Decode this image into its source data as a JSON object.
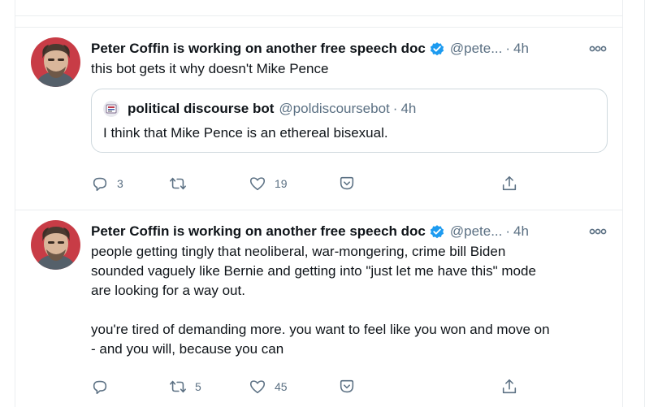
{
  "tweets": [
    {
      "display_name": "Peter Coffin is working on another free speech doc",
      "handle": "@pete...",
      "separator": "·",
      "time": "4h",
      "text": [
        "this bot gets it why doesn't Mike Pence"
      ],
      "quote": {
        "display_name": "political discourse bot",
        "handle": "@poldiscoursebot",
        "separator": "·",
        "time": "4h",
        "text": "I think that Mike Pence is an ethereal bisexual."
      },
      "reply_count": "3",
      "retweet_count": "",
      "like_count": "19"
    },
    {
      "display_name": "Peter Coffin is working on another free speech doc",
      "handle": "@pete...",
      "separator": "·",
      "time": "4h",
      "text": [
        "people getting tingly that neoliberal, war-mongering, crime bill Biden",
        "sounded vaguely like Bernie and getting into \"just let me have this\" mode",
        "are looking for a way out.",
        "",
        "you're tired of demanding more. you want to feel like you won and move on",
        "- and you will, because you can"
      ],
      "reply_count": "",
      "retweet_count": "5",
      "like_count": "45"
    }
  ],
  "colors": {
    "text_primary": "#0f1419",
    "text_secondary": "#5b7083",
    "border": "#ebeef0",
    "verified": "#1d9bf0"
  }
}
